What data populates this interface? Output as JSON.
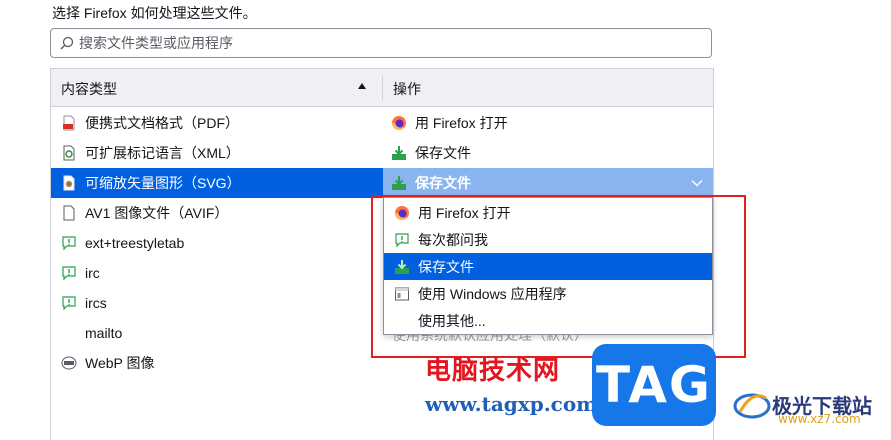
{
  "intro_text": "选择 Firefox 如何处理这些文件。",
  "search": {
    "placeholder": "搜索文件类型或应用程序"
  },
  "table": {
    "col_type": "内容类型",
    "col_action": "操作",
    "rows": [
      {
        "type": "便携式文档格式（PDF）",
        "type_icon": "pdf-file-icon",
        "action": "用 Firefox 打开",
        "action_icon": "firefox-icon"
      },
      {
        "type": "可扩展标记语言（XML）",
        "type_icon": "xml-file-icon",
        "action": "保存文件",
        "action_icon": "save-download-icon"
      },
      {
        "type": "可缩放矢量图形（SVG）",
        "type_icon": "svg-file-icon",
        "action": "保存文件",
        "action_icon": "save-download-icon",
        "selected": true
      },
      {
        "type": "AV1 图像文件（AVIF）",
        "type_icon": "blank-file-icon"
      },
      {
        "type": "ext+treestyletab",
        "type_icon": "ask-icon"
      },
      {
        "type": "irc",
        "type_icon": "ask-icon"
      },
      {
        "type": "ircs",
        "type_icon": "ask-icon"
      },
      {
        "type": "mailto",
        "type_icon": ""
      },
      {
        "type": "WebP 图像",
        "type_icon": "webp-file-icon"
      }
    ],
    "hidden_action": "使用系统默认应用处理（默认）"
  },
  "dropdown": {
    "items": [
      {
        "label": "用 Firefox 打开",
        "icon": "firefox-icon"
      },
      {
        "label": "每次都问我",
        "icon": "ask-icon"
      },
      {
        "label": "保存文件",
        "icon": "save-download-icon",
        "highlighted": true
      },
      {
        "label": "使用 Windows 应用程序",
        "icon": "windows-app-icon"
      },
      {
        "label": "使用其他...",
        "icon": ""
      }
    ]
  },
  "watermark": {
    "site_name": "电脑技术网",
    "url": "www.tagxp.com",
    "tag": "TAG",
    "brand2": "极光下载站",
    "brand2_url": "www.xz7.com"
  },
  "colors": {
    "accent": "#0060df",
    "selected_combo": "#8ab4ed",
    "annotation": "#e02020"
  }
}
